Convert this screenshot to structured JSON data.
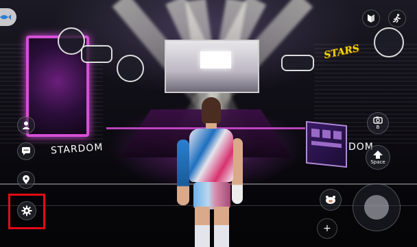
{
  "scene": {
    "banner_left": "STARDOM",
    "banner_right": "DOM",
    "stars_logo": "STARS",
    "colors": {
      "accent_pink": "#d64fd8",
      "highlight_red": "#e30b17",
      "stars_yellow": "#f2d60a"
    }
  },
  "hud": {
    "left_menu": [
      {
        "name": "avatar",
        "icon": "person-silhouette-icon"
      },
      {
        "name": "chat",
        "icon": "chat-bubble-icon"
      },
      {
        "name": "location",
        "icon": "map-pin-icon"
      },
      {
        "name": "settings",
        "icon": "gear-icon"
      }
    ],
    "top_right": [
      {
        "name": "beginner",
        "icon": "beginner-mark-icon"
      },
      {
        "name": "action",
        "icon": "running-person-icon"
      }
    ],
    "camera_button": {
      "icon": "camera-icon",
      "key_label": "B"
    },
    "jump_button": {
      "icon": "arrow-up-icon",
      "key_label": "Space"
    },
    "emote_button": {
      "icon": "emote-icon"
    },
    "add_button": {
      "icon": "plus-icon",
      "label": "+"
    },
    "joystick": {
      "icon": "joystick-icon"
    }
  }
}
